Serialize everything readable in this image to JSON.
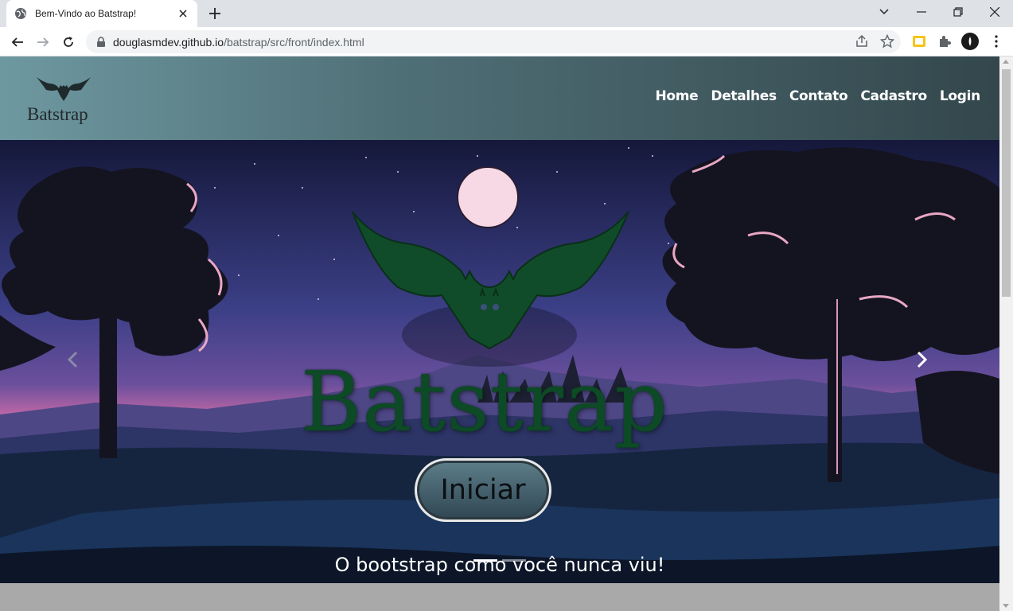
{
  "browser": {
    "tab_title": "Bem-Vindo ao Batstrap!",
    "url_host": "douglasmdev.github.io",
    "url_path": "/batstrap/src/front/index.html"
  },
  "site": {
    "brand": "Batstrap",
    "nav": [
      "Home",
      "Detalhes",
      "Contato",
      "Cadastro",
      "Login"
    ],
    "hero_title": "Batstrap",
    "start_button": "Iniciar",
    "caption": "O bootstrap como você nunca viu!",
    "carousel_active_index": 0,
    "carousel_count": 2
  },
  "colors": {
    "header_left": "#6e98a0",
    "header_right": "#33474c",
    "bat_green": "#0d4a26",
    "sky_top": "#1b1d3f",
    "sky_pink": "#d0669a"
  }
}
